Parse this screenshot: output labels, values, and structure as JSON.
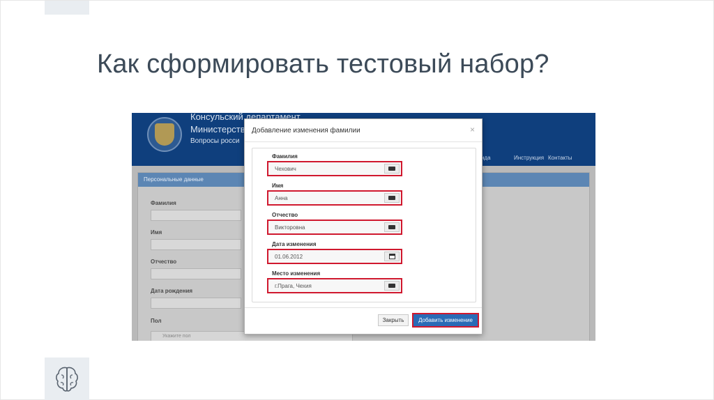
{
  "slide": {
    "title": "Как сформировать тестовый набор?",
    "icons": {
      "bottom": "brain-icon"
    }
  },
  "site": {
    "header_lines": [
      "Консульский департамент",
      "Министерств",
      "Вопросы росси"
    ],
    "nav": [
      "нда",
      "Инструкция",
      "Контакты"
    ],
    "emblem": "state-emblem-icon"
  },
  "form_panel": {
    "title": "Персональные данные",
    "labels": [
      "Фамилия",
      "Имя",
      "Отчество",
      "Дата рождения",
      "Пол"
    ],
    "select_placeholder": "Укажите пол"
  },
  "modal": {
    "title": "Добавление изменения фамилии",
    "close_symbol": "×",
    "fields": [
      {
        "label": "Фамилия",
        "value": "Чехович",
        "icon": "keyboard-icon"
      },
      {
        "label": "Имя",
        "value": "Анна",
        "icon": "keyboard-icon"
      },
      {
        "label": "Отчество",
        "value": "Викторовна",
        "icon": "keyboard-icon"
      },
      {
        "label": "Дата изменения",
        "value": "01.06.2012",
        "icon": "calendar-icon"
      },
      {
        "label": "Место изменения",
        "value": "г.Прага, Чехия",
        "icon": "keyboard-icon"
      }
    ],
    "buttons": {
      "close": "Закрыть",
      "add": "Добавить изменение"
    },
    "highlight_color": "#d0182e"
  },
  "colors": {
    "header": "#0f3f7d",
    "title_text": "#3c4a58",
    "primary_button": "#2a6bb6"
  }
}
